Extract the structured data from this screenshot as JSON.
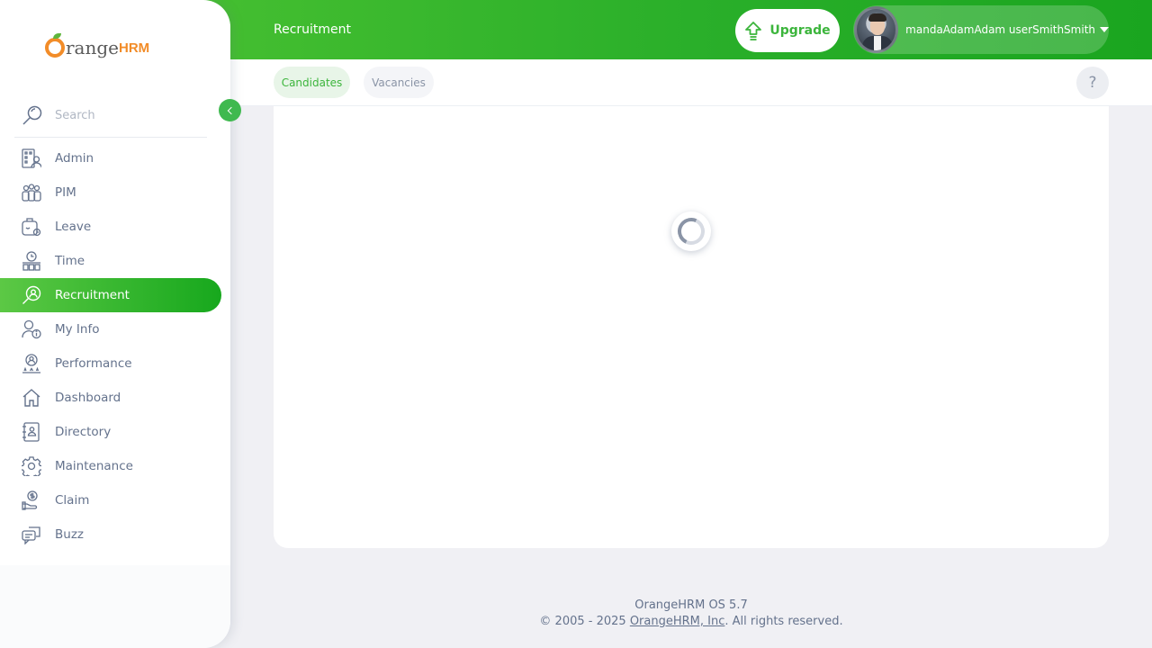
{
  "topbar": {
    "title": "Recruitment",
    "upgrade_label": "Upgrade",
    "user_name": "mandaAdamAdam userSmithSmith"
  },
  "subnav": {
    "tabs": [
      {
        "label": "Candidates",
        "active": true
      },
      {
        "label": "Vacancies",
        "active": false
      }
    ],
    "help_label": "?"
  },
  "sidebar": {
    "brand": {
      "prefix": "range",
      "suffix": "HRM"
    },
    "search": {
      "placeholder": "Search",
      "value": ""
    },
    "items": [
      {
        "label": "Admin",
        "icon": "admin-icon"
      },
      {
        "label": "PIM",
        "icon": "pim-icon"
      },
      {
        "label": "Leave",
        "icon": "leave-icon"
      },
      {
        "label": "Time",
        "icon": "time-icon"
      },
      {
        "label": "Recruitment",
        "icon": "recruitment-icon",
        "active": true
      },
      {
        "label": "My Info",
        "icon": "my-info-icon"
      },
      {
        "label": "Performance",
        "icon": "performance-icon"
      },
      {
        "label": "Dashboard",
        "icon": "dashboard-icon"
      },
      {
        "label": "Directory",
        "icon": "directory-icon"
      },
      {
        "label": "Maintenance",
        "icon": "maintenance-icon"
      },
      {
        "label": "Claim",
        "icon": "claim-icon"
      },
      {
        "label": "Buzz",
        "icon": "buzz-icon"
      }
    ]
  },
  "main": {
    "loading": true
  },
  "footer": {
    "version": "OrangeHRM OS 5.7",
    "copyright_prefix": "© 2005 - 2025 ",
    "company_link": "OrangeHRM, Inc",
    "copyright_suffix": ". All rights reserved."
  },
  "colors": {
    "accent": "#3cb53c",
    "topbar_start": "#50c533",
    "topbar_end": "#1aa51f",
    "brand_orange": "#f28c28",
    "text_muted": "#64728c"
  }
}
